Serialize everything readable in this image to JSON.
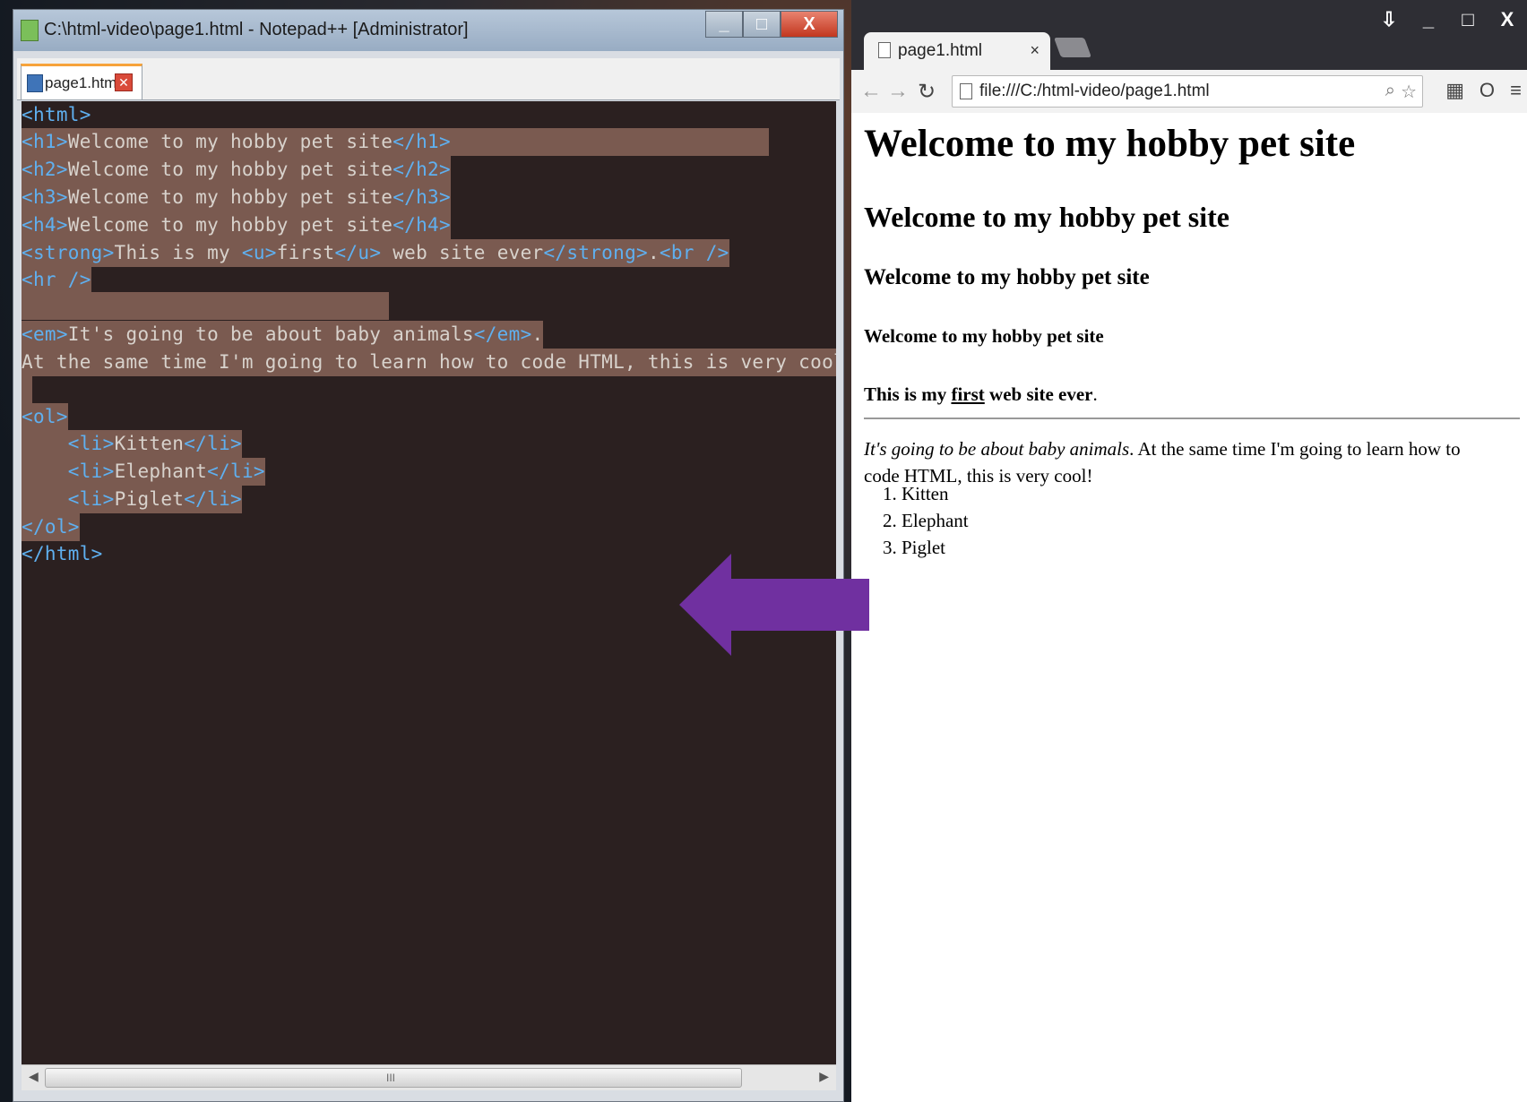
{
  "notepad": {
    "title": "C:\\html-video\\page1.html - Notepad++ [Administrator]",
    "tab_label": "page1.html",
    "window_buttons": {
      "minimize": "_",
      "maximize": "□",
      "close": "X"
    },
    "code_lines": [
      "<html>",
      "<h1>Welcome to my hobby pet site</h1>",
      "<h2>Welcome to my hobby pet site</h2>",
      "<h3>Welcome to my hobby pet site</h3>",
      "<h4>Welcome to my hobby pet site</h4>",
      "<strong>This is my <u>first</u> web site ever</strong>.<br />",
      "<hr />",
      "",
      "<em>It's going to be about baby animals</em>.",
      "At the same time I'm going to learn how to code HTML, this is very cool!",
      "",
      "<ol>",
      "    <li>Kitten</li>",
      "    <li>Elephant</li>",
      "    <li>Piglet</li>",
      "</ol>",
      "</html>"
    ],
    "scroll_grip": "III"
  },
  "browser": {
    "tab_label": "page1.html",
    "tab_close": "×",
    "url": "file:///C:/html-video/page1.html",
    "window_buttons": {
      "minimize": "_",
      "maximize": "□",
      "close": "X"
    },
    "page": {
      "h1": "Welcome to my hobby pet site",
      "h2": "Welcome to my hobby pet site",
      "h3": "Welcome to my hobby pet site",
      "h4": "Welcome to my hobby pet site",
      "strong_before": "This is my ",
      "strong_underlined": "first",
      "strong_after": " web site ever",
      "strong_period": ".",
      "em_text": "It's going to be about baby animals",
      "em_period": ".",
      "para_rest": " At the same time I'm going to learn how to code HTML, this is very cool!",
      "list": [
        "Kitten",
        "Elephant",
        "Piglet"
      ]
    }
  },
  "colors": {
    "arrow": "#7030a0",
    "editor_bg": "#2b2020",
    "selection": "#7a5a50",
    "tag": "#5fb0f0"
  }
}
